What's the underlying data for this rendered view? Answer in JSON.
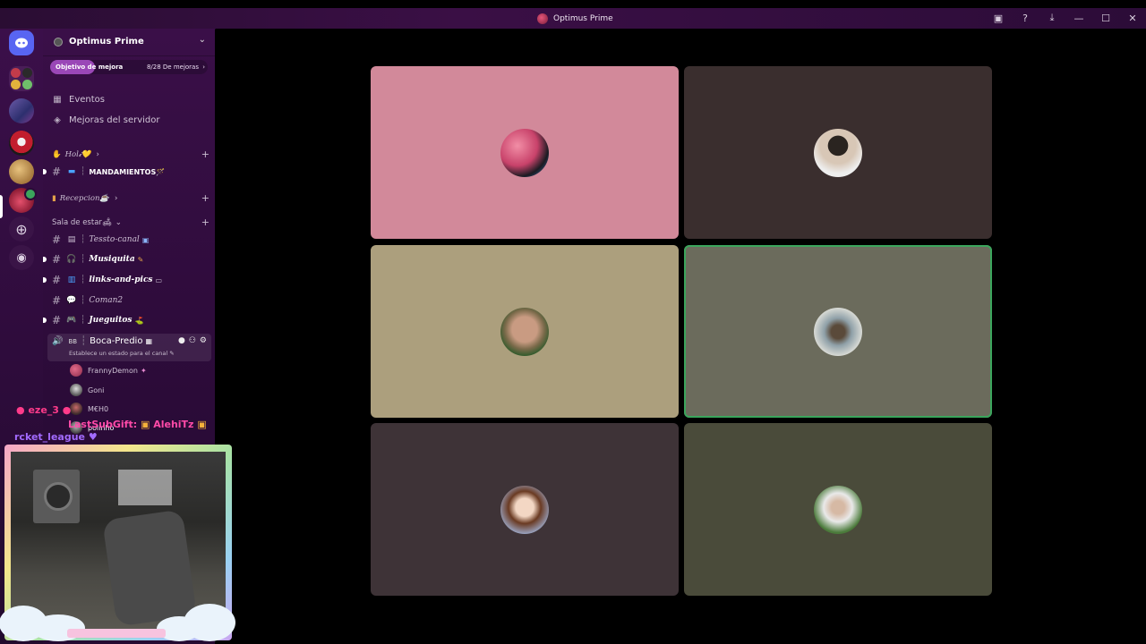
{
  "window": {
    "title": "Optimus Prime",
    "icons": [
      "inbox-icon",
      "help-icon",
      "download-icon",
      "minimize-icon",
      "maximize-icon",
      "close-icon"
    ]
  },
  "server": {
    "name": "Optimus Prime",
    "boost_goal_label": "Objetivo de mejora",
    "boost_progress_label": "8/28 De mejoras",
    "boost_progress": 0.2857
  },
  "nav": {
    "events": "Eventos",
    "boosts": "Mejoras del servidor"
  },
  "categories": {
    "hola": "Hol𝓲💛",
    "recepcion": "Recepcion☕",
    "sala": "Sala de estar🛋"
  },
  "channels": {
    "mandamientos": "MANDAMIENTOS🪄",
    "tessto": "Tessto-canal",
    "musiquita": "Musiquita",
    "links": "links-and-pics",
    "coman2": "Coman2",
    "jueguitos": "Jueguitos"
  },
  "voice": {
    "channel": "Boca-Predio",
    "status_prompt": "Establece un estado para el canal",
    "users": [
      "FrannyDemon",
      "Goni",
      "M€H0",
      "polinho"
    ]
  },
  "stream_overlay": {
    "chat_user_1": "eze_3",
    "chat_user_2": "rcket_league",
    "gift_text": "LastSubGift:",
    "gift_user": "AlehiTz"
  },
  "colors": {
    "accent": "#9a47b7",
    "speaking": "#3ba55c",
    "tiles": [
      "#d2899a",
      "#3a2e2e",
      "#ac9f7d",
      "#6b6b5c",
      "#3e3337",
      "#4a4b3a"
    ]
  }
}
